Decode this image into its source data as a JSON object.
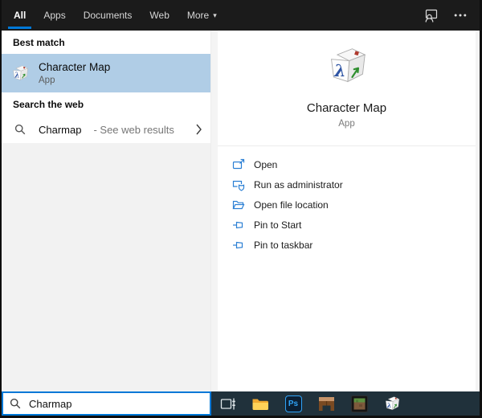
{
  "topbar": {
    "tabs": [
      {
        "label": "All",
        "active": true
      },
      {
        "label": "Apps"
      },
      {
        "label": "Documents"
      },
      {
        "label": "Web"
      },
      {
        "label": "More",
        "caret": "▾"
      }
    ]
  },
  "best_match": {
    "section_label": "Best match",
    "result_title": "Character Map",
    "result_subtitle": "App"
  },
  "web_search": {
    "section_label": "Search the web",
    "query": "Charmap",
    "suffix": "- See web results"
  },
  "preview": {
    "title": "Character Map",
    "subtitle": "App",
    "actions": [
      {
        "label": "Open"
      },
      {
        "label": "Run as administrator"
      },
      {
        "label": "Open file location"
      },
      {
        "label": "Pin to Start"
      },
      {
        "label": "Pin to taskbar"
      }
    ]
  },
  "search_box": {
    "value": "Charmap"
  },
  "taskbar": {
    "photoshop_label": "Ps"
  },
  "colors": {
    "accent": "#0078d7",
    "selection_highlight": "#b0cde6",
    "topbar_bg": "#1b1b1b",
    "taskbar_bg": "#20313b",
    "action_icon_blue": "#2b7fd4"
  }
}
